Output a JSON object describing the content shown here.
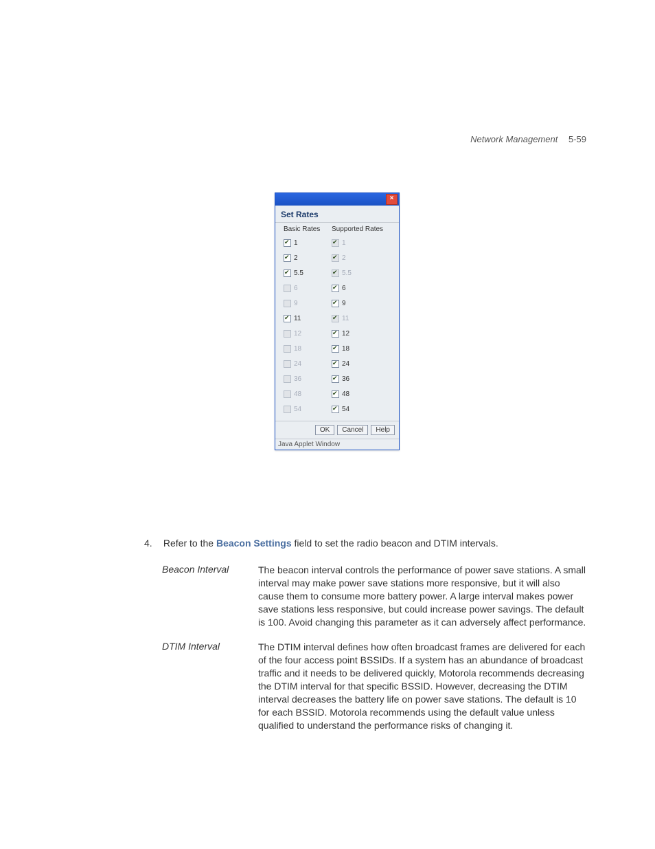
{
  "header": {
    "section": "Network Management",
    "page": "5-59"
  },
  "dialog": {
    "title": "Set Rates",
    "col_basic": "Basic Rates",
    "col_supported": "Supported Rates",
    "buttons": {
      "ok": "OK",
      "cancel": "Cancel",
      "help": "Help"
    },
    "status": "Java Applet Window",
    "rates": [
      {
        "label": "1",
        "basic_checked": true,
        "basic_disabled": false,
        "supported_checked": true,
        "supported_disabled": true
      },
      {
        "label": "2",
        "basic_checked": true,
        "basic_disabled": false,
        "supported_checked": true,
        "supported_disabled": true
      },
      {
        "label": "5.5",
        "basic_checked": true,
        "basic_disabled": false,
        "supported_checked": true,
        "supported_disabled": true
      },
      {
        "label": "6",
        "basic_checked": false,
        "basic_disabled": true,
        "supported_checked": true,
        "supported_disabled": false
      },
      {
        "label": "9",
        "basic_checked": false,
        "basic_disabled": true,
        "supported_checked": true,
        "supported_disabled": false
      },
      {
        "label": "11",
        "basic_checked": true,
        "basic_disabled": false,
        "supported_checked": true,
        "supported_disabled": true
      },
      {
        "label": "12",
        "basic_checked": false,
        "basic_disabled": true,
        "supported_checked": true,
        "supported_disabled": false
      },
      {
        "label": "18",
        "basic_checked": false,
        "basic_disabled": true,
        "supported_checked": true,
        "supported_disabled": false
      },
      {
        "label": "24",
        "basic_checked": false,
        "basic_disabled": true,
        "supported_checked": true,
        "supported_disabled": false
      },
      {
        "label": "36",
        "basic_checked": false,
        "basic_disabled": true,
        "supported_checked": true,
        "supported_disabled": false
      },
      {
        "label": "48",
        "basic_checked": false,
        "basic_disabled": true,
        "supported_checked": true,
        "supported_disabled": false
      },
      {
        "label": "54",
        "basic_checked": false,
        "basic_disabled": true,
        "supported_checked": true,
        "supported_disabled": false
      }
    ]
  },
  "step": {
    "number": "4.",
    "pre": "Refer to the ",
    "bold": "Beacon Settings",
    "post": " field to set the radio beacon and DTIM intervals."
  },
  "defs": [
    {
      "term": "Beacon Interval",
      "desc": "The beacon interval controls the performance of power save stations. A small interval may make power save stations more responsive, but it will also cause them to consume more battery power. A large interval makes power save stations less responsive, but could increase power savings. The default is 100. Avoid changing this parameter as it can adversely affect performance."
    },
    {
      "term": "DTIM Interval",
      "desc": "The DTIM interval defines how often broadcast frames are delivered for each of the four access point BSSIDs. If a system has an abundance of broadcast traffic and it needs to be delivered quickly, Motorola recommends decreasing the DTIM interval for that specific BSSID. However, decreasing the DTIM interval decreases the battery life on power save stations. The default is 10 for each BSSID. Motorola recommends using the default value unless qualified to understand the performance risks of changing it."
    }
  ]
}
